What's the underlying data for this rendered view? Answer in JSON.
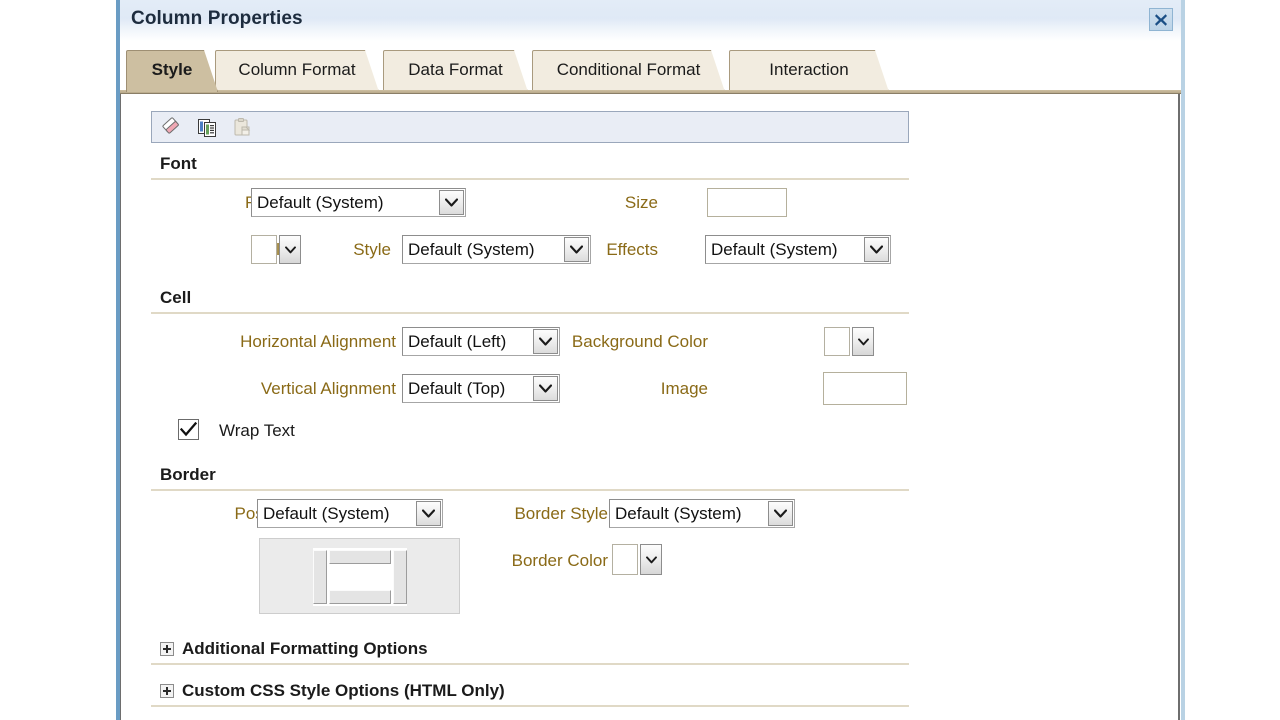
{
  "window": {
    "title": "Column Properties",
    "close_icon": "close-x-icon"
  },
  "tabs": [
    {
      "label": "Style",
      "active": true
    },
    {
      "label": "Column Format",
      "active": false
    },
    {
      "label": "Data Format",
      "active": false
    },
    {
      "label": "Conditional Format",
      "active": false
    },
    {
      "label": "Interaction",
      "active": false
    }
  ],
  "toolbar": {
    "clear_icon": "eraser-icon",
    "copy_icon": "copy-icon",
    "paste_icon": "paste-icon"
  },
  "sections": {
    "font": {
      "title": "Font",
      "family": {
        "label": "Family",
        "value": "Default (System)"
      },
      "size": {
        "label": "Size",
        "value": "",
        "placeholder": ""
      },
      "color": {
        "label": "Color",
        "value": "#ffffff"
      },
      "style": {
        "label": "Style",
        "value": "Default (System)"
      },
      "effects": {
        "label": "Effects",
        "value": "Default (System)"
      }
    },
    "cell": {
      "title": "Cell",
      "horizontal_alignment": {
        "label": "Horizontal Alignment",
        "value": "Default (Left)"
      },
      "vertical_alignment": {
        "label": "Vertical Alignment",
        "value": "Default (Top)"
      },
      "background_color": {
        "label": "Background Color",
        "value": "#ffffff"
      },
      "image": {
        "label": "Image",
        "value": "",
        "placeholder": ""
      },
      "wrap_text": {
        "label": "Wrap Text",
        "checked": true
      }
    },
    "border": {
      "title": "Border",
      "position": {
        "label": "Position",
        "value": "Default (System)"
      },
      "border_style": {
        "label": "Border Style",
        "value": "Default (System)"
      },
      "border_color": {
        "label": "Border Color",
        "value": "#ffffff"
      },
      "preview_name": "border-position-picker"
    }
  },
  "expandables": [
    {
      "label": "Additional Formatting Options"
    },
    {
      "label": "Custom CSS Style Options (HTML Only)"
    }
  ],
  "colors": {
    "label_brown": "#8a6a17",
    "tab_active": "#cdbfa1",
    "tab_inactive": "#f2ece0",
    "toolbar_bg": "#e9edf5",
    "title_bar": "#e3ecf7",
    "rule": "#e0d9c6"
  }
}
